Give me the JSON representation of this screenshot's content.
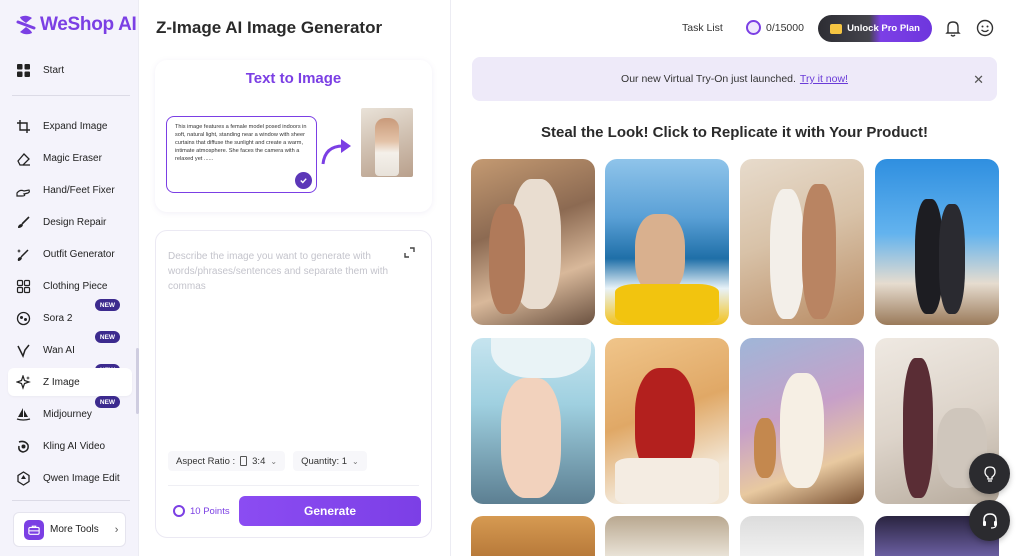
{
  "brand": {
    "name": "WeShop AI"
  },
  "sidebar": {
    "start": "Start",
    "items": [
      {
        "label": "Expand Image",
        "icon": "crop-icon"
      },
      {
        "label": "Magic Eraser",
        "icon": "eraser-icon"
      },
      {
        "label": "Hand/Feet Fixer",
        "icon": "hand-icon"
      },
      {
        "label": "Design Repair",
        "icon": "brush-icon"
      },
      {
        "label": "Outfit Generator",
        "icon": "sparkle-brush-icon"
      },
      {
        "label": "Clothing Piece",
        "icon": "grid-icon"
      },
      {
        "label": "Sora 2",
        "icon": "sora-icon",
        "badge": "NEW"
      },
      {
        "label": "Wan AI",
        "icon": "wan-icon",
        "badge": "NEW"
      },
      {
        "label": "Z Image",
        "icon": "sparkle-icon",
        "badge": "NEW"
      },
      {
        "label": "Midjourney",
        "icon": "sailboat-icon",
        "badge": "NEW"
      },
      {
        "label": "Kling AI Video",
        "icon": "kling-icon"
      },
      {
        "label": "Qwen Image Edit",
        "icon": "qwen-icon"
      }
    ],
    "more_tools": "More Tools"
  },
  "generator": {
    "title": "Z-Image AI Image Generator",
    "card_title": "Text to Image",
    "sample_text": "This image features a female model posed indoors in soft, natural light, standing near a window with sheer curtains that diffuse the sunlight and create a warm, intimate atmosphere. She faces the camera with a relaxed yet  ......",
    "prompt_placeholder": "Describe the image you want to generate with words/phrases/sentences and separate them with commas",
    "aspect_label": "Aspect Ratio :",
    "aspect_value": "3:4",
    "quantity_label": "Quantity: 1",
    "points": "10 Points",
    "generate": "Generate"
  },
  "topbar": {
    "task_list": "Task List",
    "credits": "0/15000",
    "unlock": "Unlock Pro Plan"
  },
  "banner": {
    "text": "Our new Virtual Try-On just launched.",
    "link": "Try it now!"
  },
  "gallery": {
    "title": "Steal the Look! Click to Replicate it with Your Product!"
  },
  "colors": {
    "accent": "#7b3fe4",
    "badge": "#3c2a8e",
    "banner_bg": "#eeeaf9"
  }
}
